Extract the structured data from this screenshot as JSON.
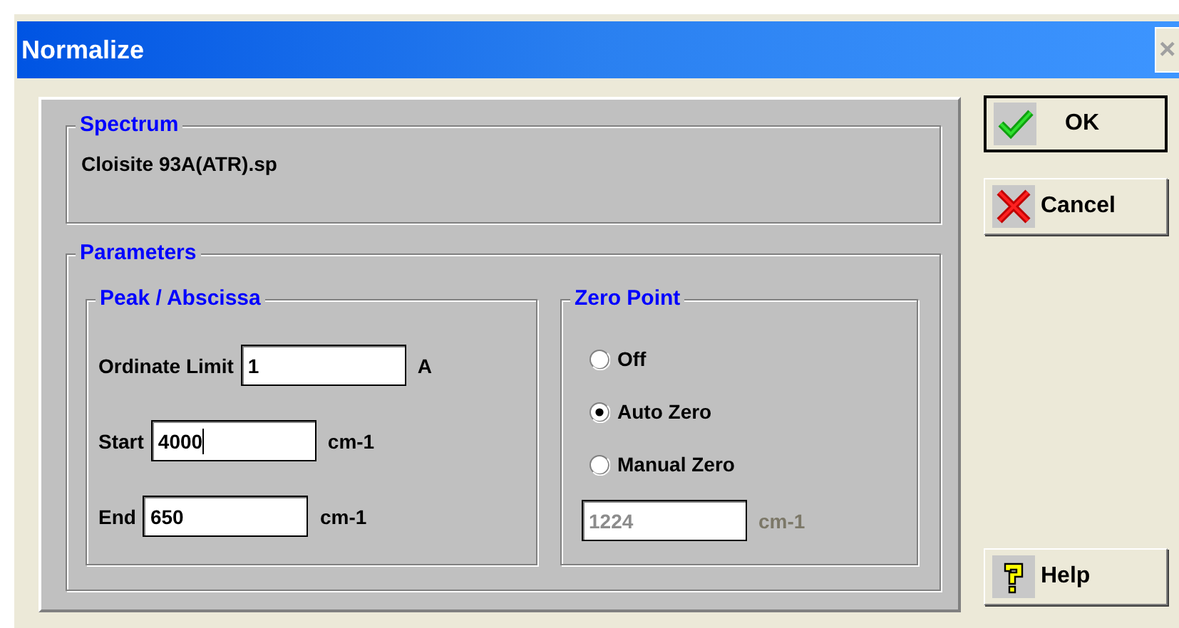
{
  "window": {
    "title": "Normalize",
    "close_label": "×"
  },
  "spectrum": {
    "legend": "Spectrum",
    "file": "Cloisite 93A(ATR).sp"
  },
  "parameters": {
    "legend": "Parameters",
    "peak": {
      "legend": "Peak / Abscissa",
      "fields": [
        {
          "label": "Ordinate Limit",
          "value": "1",
          "unit": "A",
          "focused": false
        },
        {
          "label": "Start",
          "value": "4000",
          "unit": "cm-1",
          "focused": true
        },
        {
          "label": "End",
          "value": "650",
          "unit": "cm-1",
          "focused": false
        }
      ]
    },
    "zero_point": {
      "legend": "Zero Point",
      "options": [
        {
          "label": "Off",
          "selected": false
        },
        {
          "label": "Auto Zero",
          "selected": true
        },
        {
          "label": "Manual Zero",
          "selected": false
        }
      ],
      "manual": {
        "value": "1224",
        "unit": "cm-1",
        "disabled": true
      }
    }
  },
  "buttons": [
    {
      "kind": "ok",
      "label": "OK",
      "default": true
    },
    {
      "kind": "cancel",
      "label": "Cancel",
      "default": false
    },
    {
      "kind": "help",
      "label": "Help",
      "default": false
    }
  ]
}
